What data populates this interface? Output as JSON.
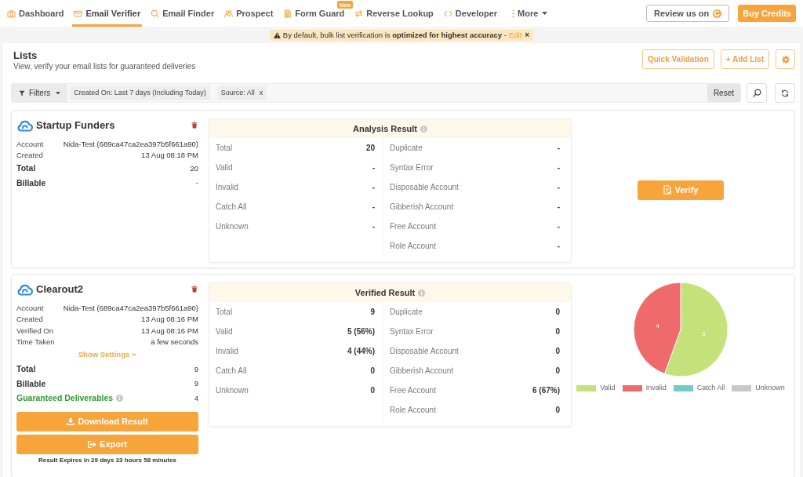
{
  "nav": {
    "items": [
      {
        "label": "Dashboard",
        "selected": false
      },
      {
        "label": "Email Verifier",
        "selected": true
      },
      {
        "label": "Email Finder",
        "selected": false
      },
      {
        "label": "Prospect",
        "selected": false
      },
      {
        "label": "Form Guard",
        "selected": false,
        "badge": "New"
      },
      {
        "label": "Reverse Lookup",
        "selected": false
      },
      {
        "label": "Developer",
        "selected": false
      }
    ],
    "more": {
      "label": "More"
    },
    "review_button": {
      "label": "Review us on"
    },
    "buy_button": {
      "label": "Buy Credits"
    }
  },
  "notice": {
    "text": "By default, bulk list verification is **optimized for highest accuracy** -",
    "link": "Edit",
    "close": "×"
  },
  "header": {
    "title": "Lists",
    "subtitle": "View, verify your email lists for guaranteed deliveries",
    "actions": [
      {
        "label": "Quick Validation"
      },
      {
        "label": "+ Add List"
      }
    ]
  },
  "filters": {
    "button": "Filters",
    "chips": [
      {
        "label": "Created On: Last 7 days (Including Today)"
      },
      {
        "label": "Source: All",
        "remove": "x"
      }
    ],
    "reset": "Reset"
  },
  "lists": [
    {
      "name": "Startup Funders",
      "details": [
        {
          "label": "Account",
          "value": "Nida-Test (689ca47ca2ea397b5f661a90)"
        },
        {
          "label": "Created",
          "value": "13 Aug 08:18 PM"
        }
      ],
      "summary": [
        {
          "kind": "plain",
          "label": "Total",
          "value": "20"
        },
        {
          "kind": "plain",
          "label": "Billable",
          "value": "-"
        }
      ],
      "result": {
        "title": "Analysis Result",
        "left": [
          {
            "label": "Total",
            "value": "20"
          },
          {
            "label": "Valid",
            "value": "-"
          },
          {
            "label": "Invalid",
            "value": "-"
          },
          {
            "label": "Catch All",
            "value": "-"
          },
          {
            "label": "Unknown",
            "value": "-"
          }
        ],
        "right": [
          {
            "label": "Duplicate",
            "value": "-"
          },
          {
            "label": "Syntax Error",
            "value": "-"
          },
          {
            "label": "Disposable Account",
            "value": "-"
          },
          {
            "label": "Gibberish Account",
            "value": "-"
          },
          {
            "label": "Free Account",
            "value": "-"
          },
          {
            "label": "Role Account",
            "value": "-"
          }
        ]
      },
      "side": {
        "kind": "button",
        "label": "Verify"
      }
    },
    {
      "name": "Clearout2",
      "details": [
        {
          "label": "Account",
          "value": "Nida-Test (689ca47ca2ea397b5f661a90)"
        },
        {
          "label": "Created",
          "value": "13 Aug 08:16 PM"
        },
        {
          "label": "Verified On",
          "value": "13 Aug 08:16 PM"
        },
        {
          "label": "Time Taken",
          "value": "a few seconds"
        }
      ],
      "settings_link": "Show Settings",
      "summary": [
        {
          "kind": "plain",
          "label": "Total",
          "value": "9"
        },
        {
          "kind": "plain",
          "label": "Billable",
          "value": "9"
        },
        {
          "kind": "guaranteed",
          "label": "Guaranteed Deliverables",
          "value": "4"
        }
      ],
      "buttons": [
        {
          "kind": "download",
          "label": "Download Result"
        },
        {
          "kind": "export",
          "label": "Export"
        }
      ],
      "expiry": "Result Expires in 29 days 23 hours 58 minutes",
      "result": {
        "title": "Verified Result",
        "left": [
          {
            "label": "Total",
            "value": "9"
          },
          {
            "label": "Valid",
            "value": "5 (56%)"
          },
          {
            "label": "Invalid",
            "value": "4 (44%)"
          },
          {
            "label": "Catch All",
            "value": "0"
          },
          {
            "label": "Unknown",
            "value": "0"
          }
        ],
        "right": [
          {
            "label": "Duplicate",
            "value": "0"
          },
          {
            "label": "Syntax Error",
            "value": "0"
          },
          {
            "label": "Disposable Account",
            "value": "0"
          },
          {
            "label": "Gibberish Account",
            "value": "0"
          },
          {
            "label": "Free Account",
            "value": "6 (67%)"
          },
          {
            "label": "Role Account",
            "value": "0"
          }
        ]
      },
      "side": {
        "kind": "chart",
        "chart_data": {
          "type": "pie",
          "categories": [
            "Valid",
            "Invalid",
            "Catch All",
            "Unknown"
          ],
          "values": [
            5,
            4,
            0,
            0
          ],
          "colors": [
            "#c5e17a",
            "#ef6b6b",
            "#72cbc4",
            "#c8c8c8"
          ],
          "data_labels": true,
          "legend": "bottom"
        }
      }
    }
  ]
}
